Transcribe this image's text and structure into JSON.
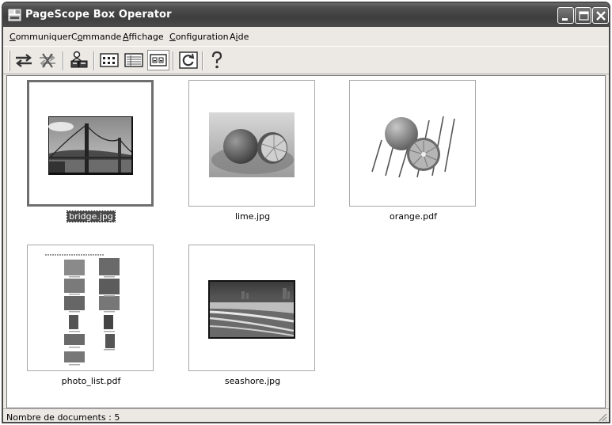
{
  "window": {
    "title": "PageScope Box Operator"
  },
  "menu": {
    "items": [
      {
        "label": "Communiquer",
        "accel": "C",
        "rest": "ommuniquer"
      },
      {
        "label": "Commande",
        "accel": "o",
        "pre": "C",
        "rest": "mmande"
      },
      {
        "label": "Affichage",
        "accel": "A",
        "rest": "ffichage"
      },
      {
        "label": "Configuration",
        "accel": "C",
        "rest": "onfiguration"
      },
      {
        "label": "Aide",
        "accel": "i",
        "pre": "A",
        "rest": "de"
      }
    ]
  },
  "toolbar": {
    "icons": [
      "transfer-icon",
      "disconnect-icon",
      "user-boxes-icon",
      "large-icons-view-icon",
      "details-view-icon",
      "thumbnail-view-icon",
      "refresh-icon",
      "help-icon"
    ]
  },
  "documents": [
    {
      "name": "bridge.jpg",
      "selected": true
    },
    {
      "name": "lime.jpg",
      "selected": false
    },
    {
      "name": "orange.pdf",
      "selected": false
    },
    {
      "name": "photo_list.pdf",
      "selected": false
    },
    {
      "name": "seashore.jpg",
      "selected": false
    }
  ],
  "status": {
    "text": "Nombre de documents : 5"
  }
}
